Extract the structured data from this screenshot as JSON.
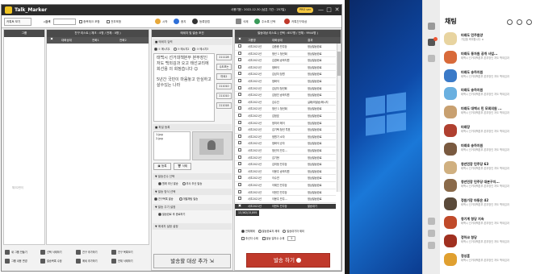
{
  "app": {
    "title": "Talk_Marker",
    "info": "사용기한 : 2022-12-30 (남은 기간 : 257일)",
    "badge": "PRO ver",
    "win_min": "—",
    "win_max": "□",
    "win_close": "✕"
  },
  "toolbar": {
    "contact_label": "카톡토 보기",
    "search_label": "검색",
    "check_dup_label": "중복체크 포함",
    "check_all_label": "전부포함",
    "start_label": "시작",
    "stop_label": "중지",
    "register_label": "등록방법",
    "delete_label": "삭제",
    "send_sel_label": "주소록 선택",
    "friend_label": "카톡친구대상"
  },
  "left_col": {
    "header": "그룹",
    "placeholder": "체크2번이",
    "buttons": [
      {
        "label": "새 그룹 만들기"
      },
      {
        "label": "선택 삭제하기"
      },
      {
        "label": "친구 추가하기"
      },
      {
        "label": "친구 목록보기"
      },
      {
        "label": "그룹 내용 변경"
      },
      {
        "label": "발송목록 수정"
      },
      {
        "label": "메세 추가하기"
      },
      {
        "label": "전체 삭제하기"
      }
    ]
  },
  "friend_col": {
    "header": "친구 리스트 ( 체크 : 0명 / 전체 : 0명 )",
    "columns": [
      "대화상대",
      "전화1",
      "전화2"
    ]
  },
  "compose": {
    "header": "메세지 및 발송 조건",
    "message_section": "■ 메세지 입력",
    "radios": [
      "① 메시지1",
      "② 메시지2",
      "③ 메시지3"
    ],
    "message1": "태백시 선거대책본부 본부장인 저도 백외김과 오고 태선교리에 회선용 의 회정습니다 ☺",
    "message2": "5년간 국민이 마음놓고 안심하고 살수있는 나라",
    "codes": [
      "211128",
      "수도보는",
      "마트2",
      "211010",
      "211010",
      "211018"
    ],
    "file_section": "■ 파일 등록",
    "files": [
      "1.jpg",
      "2.jpg"
    ],
    "file_add": "등록",
    "file_del": "삭제",
    "send_option": "▼ 발송선수 선택",
    "opt1": "원래 추신 발송",
    "opt2": "추사 추신 발송",
    "send_method": "▼ 발송 방식 선택",
    "method1": "친구목록 발송",
    "method2": "개별채팅 발송",
    "interval": "▼ 발송 주기 설정",
    "interval_val": "발송완료 후 종료하기",
    "extra": "▼ 메세지 설정 설정",
    "big_button": "발송할 대상 추가"
  },
  "send_col": {
    "header": "발송대상 리스트 ( 선택 : 657명 / 전체 : 9944명 )",
    "columns": [
      "그룹명",
      "대화상대",
      "결과"
    ],
    "rows": [
      {
        "group": "서초2021년",
        "name": "김종중 민주당",
        "result": "정상발송완료"
      },
      {
        "group": "서초2021년",
        "name": "청년 1 청년회",
        "result": "정상발송완료"
      },
      {
        "group": "서초2021년",
        "name": "김경화 송하지원",
        "result": "정상발송완료"
      },
      {
        "group": "서초2021년",
        "name": "정화석",
        "result": "정상발송완료"
      },
      {
        "group": "서초2021년",
        "name": "김성자 당원",
        "result": "정상발송완료"
      },
      {
        "group": "서초2021년",
        "name": "정화석",
        "result": "정상발송완료"
      },
      {
        "group": "서초2021년",
        "name": "김성자 청년회",
        "result": "정상발송완료"
      },
      {
        "group": "서초2021년",
        "name": "김정진 송하지원",
        "result": "정상발송완료"
      },
      {
        "group": "서초2021년",
        "name": "김수진",
        "result": "실패/미발송/메시지"
      },
      {
        "group": "서초2021년",
        "name": "청년 1 청년회",
        "result": "정상발송완료"
      },
      {
        "group": "서초2021년",
        "name": "김정호",
        "result": "정상발송완료"
      },
      {
        "group": "서초2021년",
        "name": "정미라 메이",
        "result": "정상발송완료"
      },
      {
        "group": "서초2021년",
        "name": "김기택 청년 투표",
        "result": "정상발송완료"
      },
      {
        "group": "서초2021년",
        "name": "정원기 소자",
        "result": "정상발송완료"
      },
      {
        "group": "서초2021년",
        "name": "정화석 순자",
        "result": "정상발송완료"
      },
      {
        "group": "서초2021년",
        "name": "청년의 민주...",
        "result": "정상발송완료"
      },
      {
        "group": "서초2021년",
        "name": "김기현",
        "result": "정상발송완료"
      },
      {
        "group": "서초2021년",
        "name": "김미정 민주당",
        "result": "정상발송완료"
      },
      {
        "group": "서초2021년",
        "name": "이봉주 송하지원",
        "result": "정상발송완료"
      },
      {
        "group": "서초2021년",
        "name": "이수연",
        "result": "정상발송완료"
      },
      {
        "group": "서초2021년",
        "name": "이제인 민주당",
        "result": "정상발송완료"
      },
      {
        "group": "서초2021년",
        "name": "이현진 민주당",
        "result": "정상발송완료"
      },
      {
        "group": "서초2021년",
        "name": "이봉주 민주...",
        "result": "정상발송완료"
      },
      {
        "group": "서초2021년",
        "name": "이현도 민주당",
        "result": "발송대기"
      }
    ],
    "count": "13,562/15,895",
    "opts": [
      "전체해제",
      "발송완료자 제외",
      "발송대기자 제외"
    ],
    "opt_row2": "추신자 수제",
    "opt_row2b": "발송 일자수 수제",
    "opt_num": "5",
    "stop_button": "발송 하기"
  },
  "kakao": {
    "title": "채팅",
    "chats": [
      {
        "name": "미래도 민주원양",
        "preview": "가입을 축하합니다 ★"
      },
      {
        "name": "미래도 동자원 공개 사업...",
        "preview": "태백시 선거대책본부 본부장인 저도 백외김과"
      },
      {
        "name": "미래도 송하지원",
        "preview": "태백시 선거대책본부 본부장인 저도 백외김과"
      },
      {
        "name": "미래도 송하지원",
        "preview": "태백시 선거대책본부 본부장인 저도 백외김과"
      },
      {
        "name": "미래도 대백시 민 모회의원 ...",
        "preview": "태백시 선거대책본부 본부장인 저도 백외김과"
      },
      {
        "name": "미래장",
        "preview": "태백시 선거대책본부 본부장인 저도 백외김과"
      },
      {
        "name": "미래호 송하지원",
        "preview": "태백시 선거대책본부 본부장인 저도 백외김과"
      },
      {
        "name": "청년민장 민주당 63",
        "preview": "태백시 선거대책본부 본부장인 저도 백외김과"
      },
      {
        "name": "청년민장 민주당 대본구지...",
        "preview": "태백시 선거대책본부 본부장인 저도 백외김과"
      },
      {
        "name": "정원기장 마동은 42",
        "preview": "태백시 선거대책본부 본부장인 저도 백외김과"
      },
      {
        "name": "청기계 청당 지속",
        "preview": "태백시 선거대책본부 본부장인 저도 백외김과"
      },
      {
        "name": "정하코 청당",
        "preview": "태백시 선거대책본부 본부장인 저도 백외김과"
      },
      {
        "name": "정성훈",
        "preview": "태백시 선거대책본부 본부장인 저도 백외김과"
      }
    ]
  },
  "colors": {
    "dark_header": "#4a4a4a",
    "accent_red": "#c0392b",
    "accent_blue": "#2e6fd8",
    "badge": "#f5c842"
  }
}
